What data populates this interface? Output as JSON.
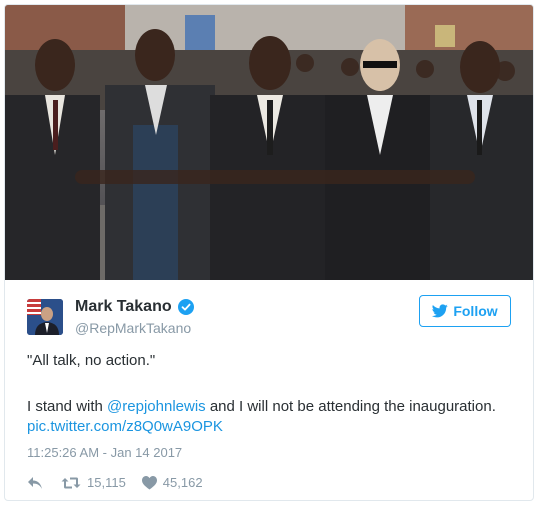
{
  "author": {
    "display_name": "Mark Takano",
    "handle": "@RepMarkTakano"
  },
  "follow_button": {
    "label": "Follow"
  },
  "tweet": {
    "quote": "\"All talk, no action.\"",
    "text_before_mention": "I stand with ",
    "mention": "@repjohnlewis",
    "text_after_mention": " and I will not be attending the inauguration. ",
    "pic_link": "pic.twitter.com/z8Q0wA9OPK"
  },
  "timestamp": "11:25:26 AM - Jan 14 2017",
  "actions": {
    "retweet_count": "15,115",
    "like_count": "45,162"
  },
  "colors": {
    "accent": "#1da1f2",
    "link": "#1b95e0",
    "muted": "#8899a6",
    "text": "#292f33"
  }
}
